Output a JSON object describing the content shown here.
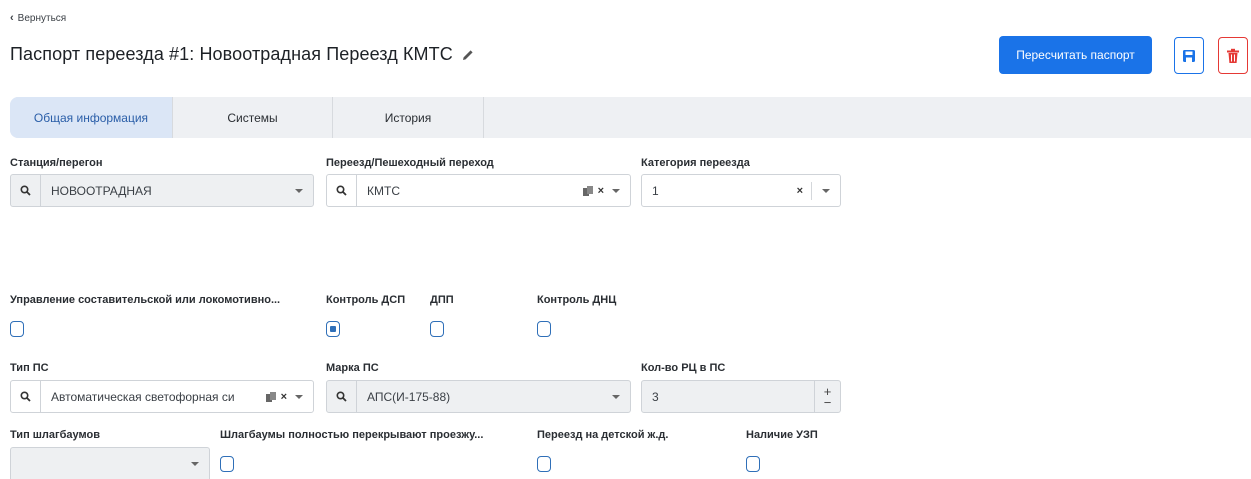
{
  "nav": {
    "back_label": "Вернуться"
  },
  "header": {
    "title": "Паспорт переезда #1: Новоотрадная Переезд КМТС",
    "recalc_label": "Пересчитать паспорт"
  },
  "tabs": [
    {
      "label": "Общая информация",
      "active": true
    },
    {
      "label": "Системы",
      "active": false
    },
    {
      "label": "История",
      "active": false
    }
  ],
  "fields": {
    "station": {
      "label": "Станция/перегон",
      "value": "НОВООТРАДНАЯ"
    },
    "crossing": {
      "label": "Переезд/Пешеходный переход",
      "value": "КМТС"
    },
    "category": {
      "label": "Категория переезда",
      "value": "1"
    },
    "shunting_control": {
      "label": "Управление составительской или локомотивно...",
      "checked": false
    },
    "dsp_control": {
      "label": "Контроль ДСП",
      "checked": true
    },
    "dpp": {
      "label": "ДПП",
      "checked": false
    },
    "dnc_control": {
      "label": "Контроль ДНЦ",
      "checked": false
    },
    "ps_type": {
      "label": "Тип ПС",
      "value": "Автоматическая светофорная си"
    },
    "ps_brand": {
      "label": "Марка ПС",
      "value": "АПС(И-175-88)"
    },
    "rc_count": {
      "label": "Кол-во РЦ в ПС",
      "value": "3"
    },
    "barrier_type": {
      "label": "Тип шлагбаумов",
      "value": ""
    },
    "barriers_full": {
      "label": "Шлагбаумы полностью перекрывают проезжу...",
      "checked": false
    },
    "childrens_railway": {
      "label": "Переезд на детской ж.д.",
      "checked": false
    },
    "uzp": {
      "label": "Наличие УЗП",
      "checked": false
    }
  },
  "colors": {
    "accent": "#1a73e8",
    "danger": "#e53935",
    "active_tab_bg": "#dbe6f6"
  },
  "icons": {
    "back": "chevron-left-icon",
    "edit": "pencil-icon",
    "save": "floppy-disk-icon",
    "delete": "trash-icon",
    "search": "search-icon",
    "copy": "copy-icon",
    "clear": "clear-x-icon",
    "caret": "caret-down-icon"
  }
}
